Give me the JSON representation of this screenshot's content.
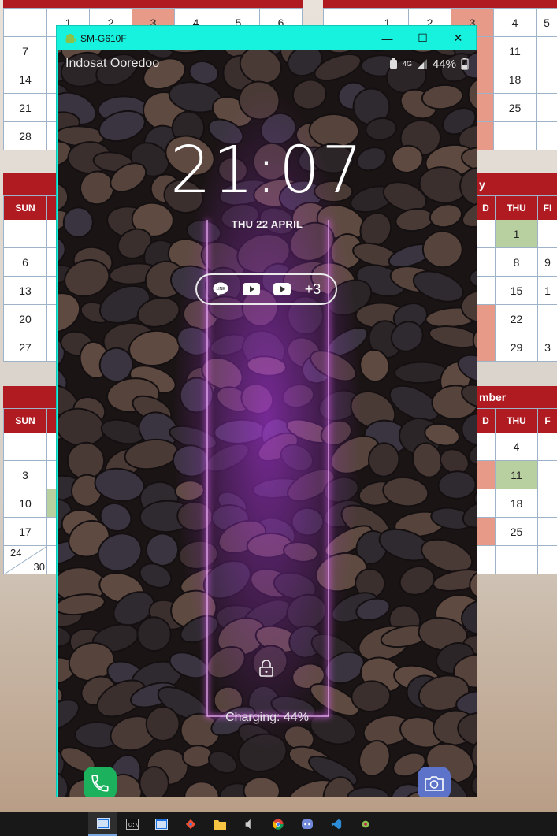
{
  "desktop": {
    "cal_top_left": {
      "row1": [
        "",
        "1",
        "2",
        "3",
        "4",
        "5",
        "6"
      ],
      "rows": [
        [
          "7"
        ],
        [
          "14"
        ],
        [
          "21"
        ],
        [
          "28"
        ]
      ]
    },
    "cal_top_right": {
      "row1": [
        "",
        "1",
        "2",
        "3",
        "4",
        "5"
      ],
      "rows": [
        [
          "11"
        ],
        [
          "18"
        ],
        [
          "25"
        ]
      ]
    },
    "cal_mid_left": {
      "head": "SUN",
      "rows": [
        "",
        "6",
        "13",
        "20",
        "27"
      ]
    },
    "cal_mid_right": {
      "month_fragment": "y",
      "heads": [
        "D",
        "THU",
        "FI"
      ],
      "thu": [
        "1",
        "8",
        "15",
        "22",
        "29"
      ],
      "fri": [
        "",
        "9",
        "1",
        "",
        "3"
      ]
    },
    "cal_bot_left": {
      "head": "SUN",
      "rows": [
        "",
        "3",
        "10",
        "17"
      ],
      "split_a": "24",
      "split_b": "30"
    },
    "cal_bot_right": {
      "month_fragment": "mber",
      "heads": [
        "D",
        "THU",
        "F"
      ],
      "thu": [
        "4",
        "11",
        "18",
        "25"
      ]
    }
  },
  "window": {
    "title": "SM-G610F",
    "minimize": "—",
    "maximize": "☐",
    "close": "✕"
  },
  "phone": {
    "carrier": "Indosat Ooredoo",
    "network": "4G",
    "battery": "44%",
    "time_h": "21",
    "time_colon": ":",
    "time_m": "07",
    "date": "THU 22 APRIL",
    "notif_more": "+3",
    "charging": "Charging: 44%"
  },
  "colors": {
    "window_frame": "#16f2de",
    "calendar_red": "#b01b22",
    "neon": "#c23bff",
    "phone_button": "#1bb15d",
    "camera_button": "#5c73c9"
  },
  "taskbar": {
    "icons": [
      "window-icon",
      "cmd-icon",
      "window-icon-2",
      "git-icon",
      "folder-icon",
      "audio-icon",
      "chrome-icon",
      "discord-icon",
      "vscode-icon",
      "android-icon"
    ]
  }
}
